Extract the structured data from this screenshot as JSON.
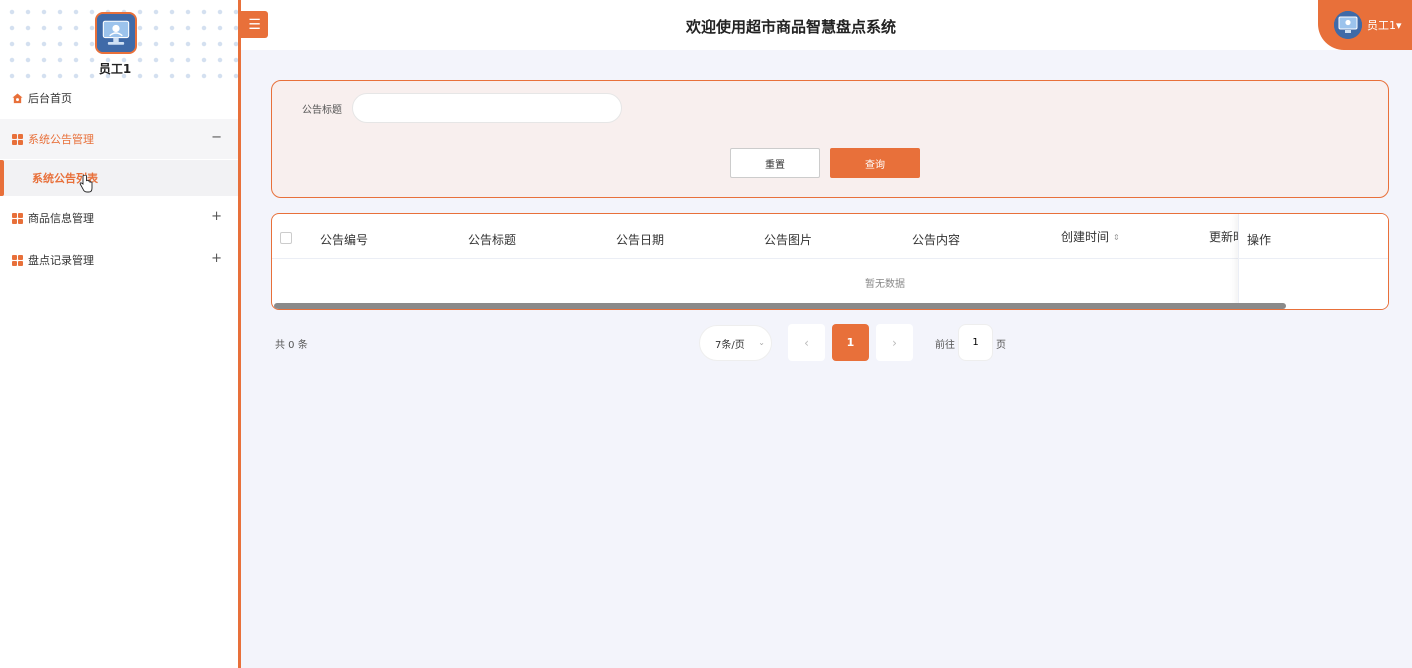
{
  "sidebar": {
    "user_name": "员工1",
    "items": [
      {
        "label": "后台首页",
        "icon": "home-icon"
      },
      {
        "label": "系统公告管理",
        "icon": "grid-icon",
        "toggle": "−"
      },
      {
        "label": "系统公告列表"
      },
      {
        "label": "商品信息管理",
        "icon": "grid-icon",
        "toggle": "+"
      },
      {
        "label": "盘点记录管理",
        "icon": "grid-icon",
        "toggle": "+"
      }
    ]
  },
  "header": {
    "menu_toggle": "☰",
    "title": "欢迎使用超市商品智慧盘点系统",
    "user_label": "员工1",
    "user_caret": "▾"
  },
  "search": {
    "label": "公告标题",
    "value": "",
    "reset_label": "重置",
    "search_label": "查询"
  },
  "table": {
    "columns": [
      "公告编号",
      "公告标题",
      "公告日期",
      "公告图片",
      "公告内容",
      "创建时间",
      "更新时"
    ],
    "sort_icon": "⇕",
    "action_column": "操作",
    "empty_text": "暂无数据"
  },
  "pagination": {
    "total": "共 0 条",
    "page_size": "7条/页",
    "page_size_caret": "⌄",
    "prev": "‹",
    "current": "1",
    "next": "›",
    "goto_label": "前往",
    "goto_value": "1",
    "goto_suffix": "页"
  },
  "colors": {
    "accent": "#e8703a",
    "panel_bg": "#f8efee",
    "page_bg": "#f3f4fb"
  }
}
